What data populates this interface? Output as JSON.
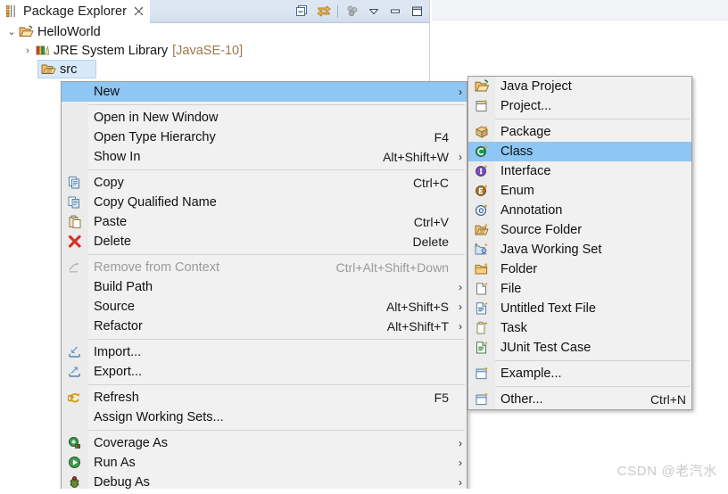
{
  "view": {
    "tab_title": "Package Explorer",
    "close_glyph": "✄",
    "toolbar": [
      {
        "name": "collapse-all-icon",
        "title": "Collapse All"
      },
      {
        "name": "link-with-editor-icon",
        "title": "Link with Editor"
      },
      {
        "name": "view-menu-icon",
        "title": "View Menu"
      },
      {
        "name": "chevron-down-icon",
        "title": "Minimize dropdown"
      },
      {
        "name": "minimize-icon",
        "title": "Minimize"
      },
      {
        "name": "maximize-icon",
        "title": "Maximize"
      }
    ]
  },
  "tree": {
    "nodes": [
      {
        "label": "HelloWorld",
        "suffix": "",
        "twisty": "v",
        "icon": "java-project-icon",
        "indent": 0,
        "selected": false
      },
      {
        "label": "JRE System Library",
        "suffix": "[JavaSE-10]",
        "twisty": ">",
        "icon": "jre-library-icon",
        "indent": 1,
        "selected": false
      },
      {
        "label": "src",
        "suffix": "",
        "twisty": "",
        "icon": "source-folder-icon",
        "indent": 1,
        "selected": true
      }
    ]
  },
  "context_menu": {
    "items": [
      {
        "label": "New",
        "accel": "",
        "arrow": true,
        "icon": "",
        "highlighted": true,
        "disabled": false
      },
      {
        "separator": true
      },
      {
        "label": "Open in New Window",
        "accel": "",
        "arrow": false,
        "icon": "",
        "highlighted": false,
        "disabled": false
      },
      {
        "label": "Open Type Hierarchy",
        "accel": "F4",
        "arrow": false,
        "icon": "",
        "highlighted": false,
        "disabled": false
      },
      {
        "label": "Show In",
        "accel": "Alt+Shift+W",
        "arrow": true,
        "icon": "",
        "highlighted": false,
        "disabled": false
      },
      {
        "separator": true
      },
      {
        "label": "Copy",
        "accel": "Ctrl+C",
        "arrow": false,
        "icon": "copy-icon",
        "highlighted": false,
        "disabled": false
      },
      {
        "label": "Copy Qualified Name",
        "accel": "",
        "arrow": false,
        "icon": "copy-qualified-name-icon",
        "highlighted": false,
        "disabled": false
      },
      {
        "label": "Paste",
        "accel": "Ctrl+V",
        "arrow": false,
        "icon": "paste-icon",
        "highlighted": false,
        "disabled": false
      },
      {
        "label": "Delete",
        "accel": "Delete",
        "arrow": false,
        "icon": "delete-icon",
        "highlighted": false,
        "disabled": false
      },
      {
        "separator": true
      },
      {
        "label": "Remove from Context",
        "accel": "Ctrl+Alt+Shift+Down",
        "arrow": false,
        "icon": "remove-from-context-icon",
        "highlighted": false,
        "disabled": true
      },
      {
        "label": "Build Path",
        "accel": "",
        "arrow": true,
        "icon": "",
        "highlighted": false,
        "disabled": false
      },
      {
        "label": "Source",
        "accel": "Alt+Shift+S",
        "arrow": true,
        "icon": "",
        "highlighted": false,
        "disabled": false
      },
      {
        "label": "Refactor",
        "accel": "Alt+Shift+T",
        "arrow": true,
        "icon": "",
        "highlighted": false,
        "disabled": false
      },
      {
        "separator": true
      },
      {
        "label": "Import...",
        "accel": "",
        "arrow": false,
        "icon": "import-icon",
        "highlighted": false,
        "disabled": false
      },
      {
        "label": "Export...",
        "accel": "",
        "arrow": false,
        "icon": "export-icon",
        "highlighted": false,
        "disabled": false
      },
      {
        "separator": true
      },
      {
        "label": "Refresh",
        "accel": "F5",
        "arrow": false,
        "icon": "refresh-icon",
        "highlighted": false,
        "disabled": false
      },
      {
        "label": "Assign Working Sets...",
        "accel": "",
        "arrow": false,
        "icon": "",
        "highlighted": false,
        "disabled": false
      },
      {
        "separator": true
      },
      {
        "label": "Coverage As",
        "accel": "",
        "arrow": true,
        "icon": "coverage-as-icon",
        "highlighted": false,
        "disabled": false
      },
      {
        "label": "Run As",
        "accel": "",
        "arrow": true,
        "icon": "run-as-icon",
        "highlighted": false,
        "disabled": false
      },
      {
        "label": "Debug As",
        "accel": "",
        "arrow": true,
        "icon": "debug-as-icon",
        "highlighted": false,
        "disabled": false
      }
    ]
  },
  "new_submenu": {
    "items": [
      {
        "label": "Java Project",
        "accel": "",
        "icon": "java-project-icon",
        "highlighted": false
      },
      {
        "label": "Project...",
        "accel": "",
        "icon": "project-icon",
        "highlighted": false
      },
      {
        "separator": true
      },
      {
        "label": "Package",
        "accel": "",
        "icon": "package-icon",
        "highlighted": false
      },
      {
        "label": "Class",
        "accel": "",
        "icon": "class-icon",
        "highlighted": true
      },
      {
        "label": "Interface",
        "accel": "",
        "icon": "interface-icon",
        "highlighted": false
      },
      {
        "label": "Enum",
        "accel": "",
        "icon": "enum-icon",
        "highlighted": false
      },
      {
        "label": "Annotation",
        "accel": "",
        "icon": "annotation-icon",
        "highlighted": false
      },
      {
        "label": "Source Folder",
        "accel": "",
        "icon": "source-folder-icon",
        "highlighted": false
      },
      {
        "label": "Java Working Set",
        "accel": "",
        "icon": "java-working-set-icon",
        "highlighted": false
      },
      {
        "label": "Folder",
        "accel": "",
        "icon": "folder-icon",
        "highlighted": false
      },
      {
        "label": "File",
        "accel": "",
        "icon": "file-icon",
        "highlighted": false
      },
      {
        "label": "Untitled Text File",
        "accel": "",
        "icon": "untitled-text-file-icon",
        "highlighted": false
      },
      {
        "label": "Task",
        "accel": "",
        "icon": "task-icon",
        "highlighted": false
      },
      {
        "label": "JUnit Test Case",
        "accel": "",
        "icon": "junit-test-case-icon",
        "highlighted": false
      },
      {
        "separator": true
      },
      {
        "label": "Example...",
        "accel": "",
        "icon": "example-icon",
        "highlighted": false
      },
      {
        "separator": true
      },
      {
        "label": "Other...",
        "accel": "Ctrl+N",
        "icon": "other-icon",
        "highlighted": false
      }
    ]
  },
  "watermark": {
    "text": "CSDN @老汽水"
  },
  "colors": {
    "menu_bg": "#f1f1f1",
    "menu_gutter": "#ebebeb",
    "highlight": "#8ec6f4",
    "tree_selection": "#d7e8f8",
    "tab_gradient": "#dce6f2",
    "dim_text": "#9b7a4a"
  }
}
